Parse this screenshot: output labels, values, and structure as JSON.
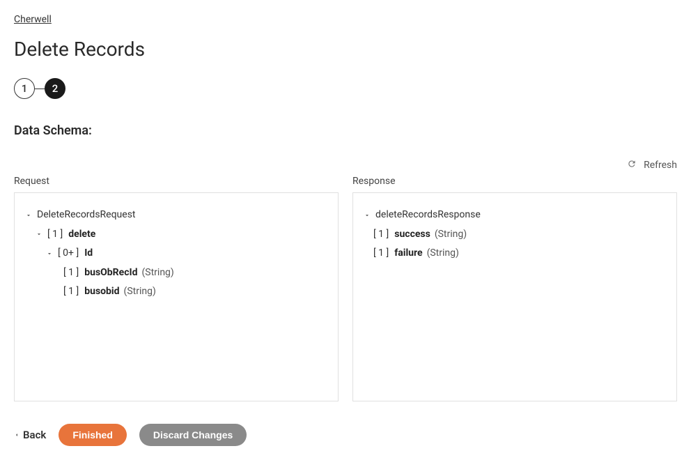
{
  "breadcrumb": "Cherwell",
  "page_title": "Delete Records",
  "stepper": {
    "step1": "1",
    "step2": "2"
  },
  "section_title": "Data Schema:",
  "refresh_label": "Refresh",
  "request": {
    "label": "Request",
    "root": "DeleteRecordsRequest",
    "delete_bracket": "[ 1 ]",
    "delete_name": "delete",
    "id_bracket": "[ 0+ ]",
    "id_name": "Id",
    "busObRecId_bracket": "[ 1 ]",
    "busObRecId_name": "busObRecId",
    "busObRecId_type": "(String)",
    "busobid_bracket": "[ 1 ]",
    "busobid_name": "busobid",
    "busobid_type": "(String)"
  },
  "response": {
    "label": "Response",
    "root": "deleteRecordsResponse",
    "success_bracket": "[ 1 ]",
    "success_name": "success",
    "success_type": "(String)",
    "failure_bracket": "[ 1 ]",
    "failure_name": "failure",
    "failure_type": "(String)"
  },
  "footer": {
    "back": "Back",
    "finished": "Finished",
    "discard": "Discard Changes"
  }
}
